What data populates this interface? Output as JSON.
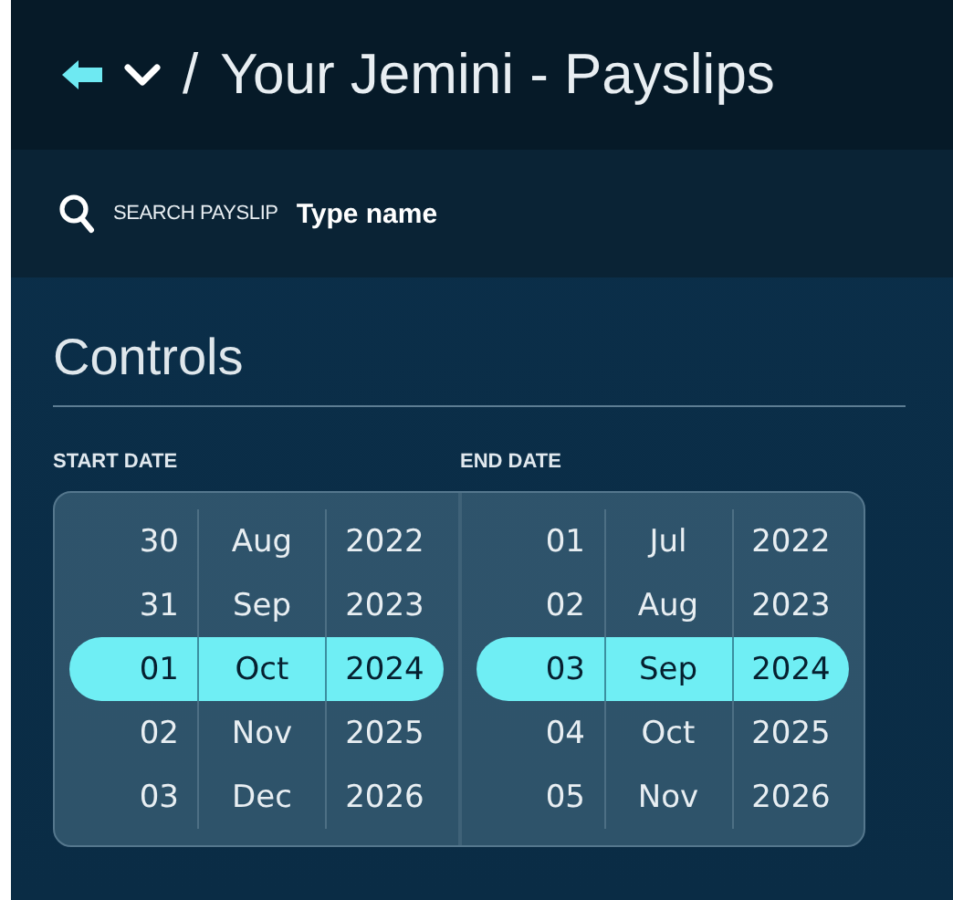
{
  "header": {
    "breadcrumb_separator": "/",
    "title": "Your Jemini - Payslips"
  },
  "search": {
    "label": "SEARCH PAYSLIP",
    "placeholder": "Type name"
  },
  "section": {
    "title": "Controls"
  },
  "pickers": [
    {
      "label": "START DATE",
      "rows": [
        {
          "day": "30",
          "month": "Aug",
          "year": "2022",
          "selected": false
        },
        {
          "day": "31",
          "month": "Sep",
          "year": "2023",
          "selected": false
        },
        {
          "day": "01",
          "month": "Oct",
          "year": "2024",
          "selected": true
        },
        {
          "day": "02",
          "month": "Nov",
          "year": "2025",
          "selected": false
        },
        {
          "day": "03",
          "month": "Dec",
          "year": "2026",
          "selected": false
        }
      ]
    },
    {
      "label": "END DATE",
      "rows": [
        {
          "day": "01",
          "month": "Jul",
          "year": "2022",
          "selected": false
        },
        {
          "day": "02",
          "month": "Aug",
          "year": "2023",
          "selected": false
        },
        {
          "day": "03",
          "month": "Sep",
          "year": "2024",
          "selected": true
        },
        {
          "day": "04",
          "month": "Oct",
          "year": "2025",
          "selected": false
        },
        {
          "day": "05",
          "month": "Nov",
          "year": "2026",
          "selected": false
        }
      ]
    }
  ]
}
